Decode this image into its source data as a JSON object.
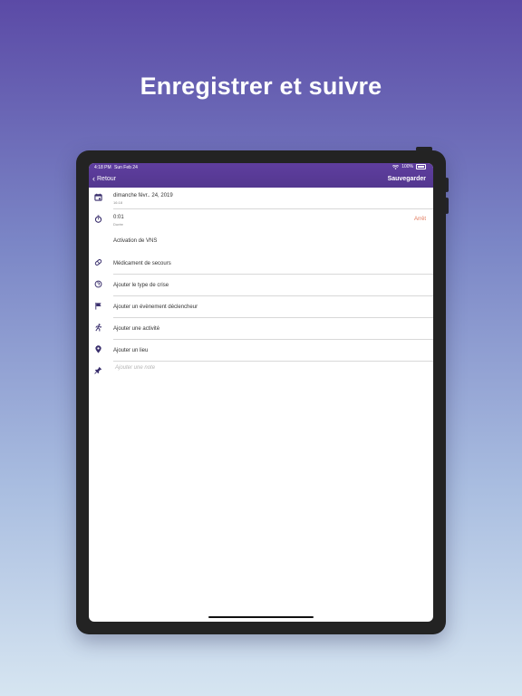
{
  "headline": "Enregistrer et suivre",
  "status_bar": {
    "time": "4:18 PM",
    "date": "Sun Feb 24",
    "battery": "100%"
  },
  "nav": {
    "back_label": "Retour",
    "save_label": "Sauvegarder"
  },
  "event": {
    "date": "dimanche févr.. 24, 2019",
    "time": "16:18",
    "duration_value": "0:01",
    "duration_label": "Durée",
    "stop_label": "Arrêt"
  },
  "rows": {
    "vns": "Activation de VNS",
    "rescue_med": "Médicament de secours",
    "seizure_type": "Ajouter le type de crise",
    "trigger": "Ajouter un évènement déclencheur",
    "activity": "Ajouter une activité",
    "location": "Ajouter un lieu",
    "note_placeholder": "Ajouter une note"
  },
  "colors": {
    "accent": "#5a3c9a",
    "stop": "#e2795b",
    "icon": "#3a2f6d"
  }
}
